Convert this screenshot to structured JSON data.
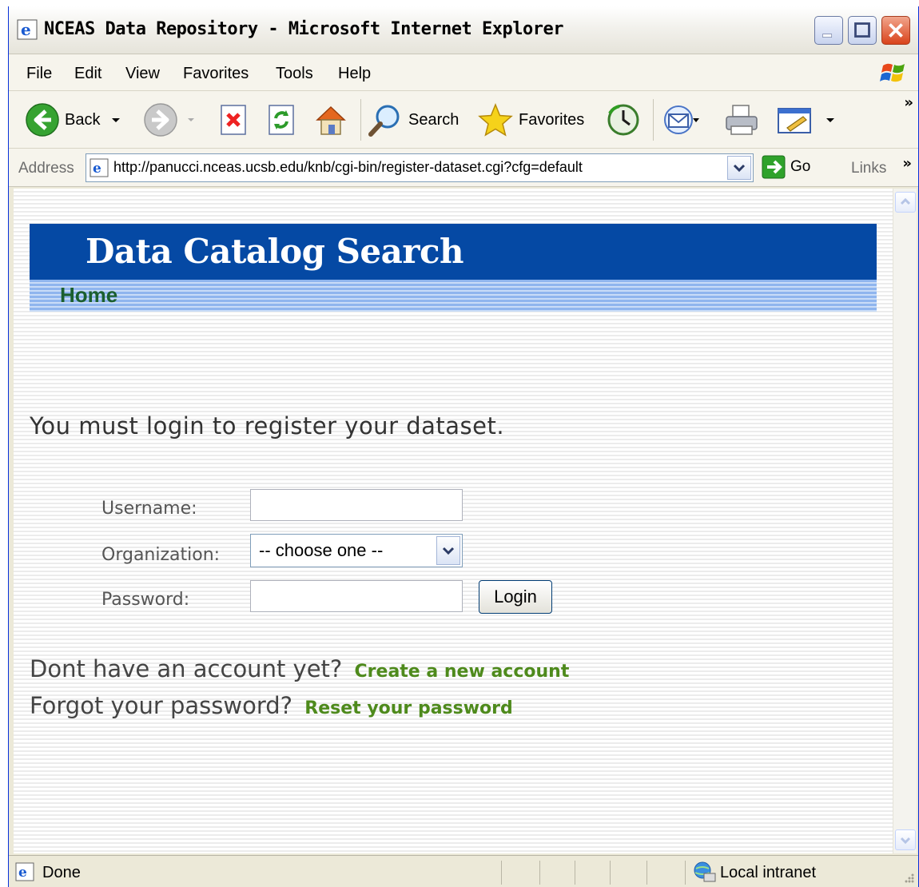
{
  "window": {
    "title": "NCEAS Data Repository - Microsoft Internet Explorer"
  },
  "menu": {
    "items": [
      "File",
      "Edit",
      "View",
      "Favorites",
      "Tools",
      "Help"
    ]
  },
  "toolbar": {
    "back_label": "Back",
    "search_label": "Search",
    "favorites_label": "Favorites"
  },
  "address": {
    "label": "Address",
    "url": "http://panucci.nceas.ucsb.edu/knb/cgi-bin/register-dataset.cgi?cfg=default",
    "go_label": "Go",
    "links_label": "Links"
  },
  "page": {
    "banner_title": "Data Catalog Search",
    "home_link": "Home",
    "login_message": "You must login to register your dataset.",
    "form": {
      "username_label": "Username:",
      "username_value": "",
      "organization_label": "Organization:",
      "organization_selected": "-- choose one --",
      "password_label": "Password:",
      "password_value": "",
      "login_button": "Login"
    },
    "no_account_text": "Dont have an account yet?",
    "create_account_link": "Create a new account",
    "forgot_text": "Forgot your password?",
    "reset_link": "Reset your password"
  },
  "status": {
    "text": "Done",
    "zone": "Local intranet"
  },
  "colors": {
    "banner": "#0549a4",
    "link_green": "#4e8a1c",
    "home_green": "#1b5f2e"
  }
}
